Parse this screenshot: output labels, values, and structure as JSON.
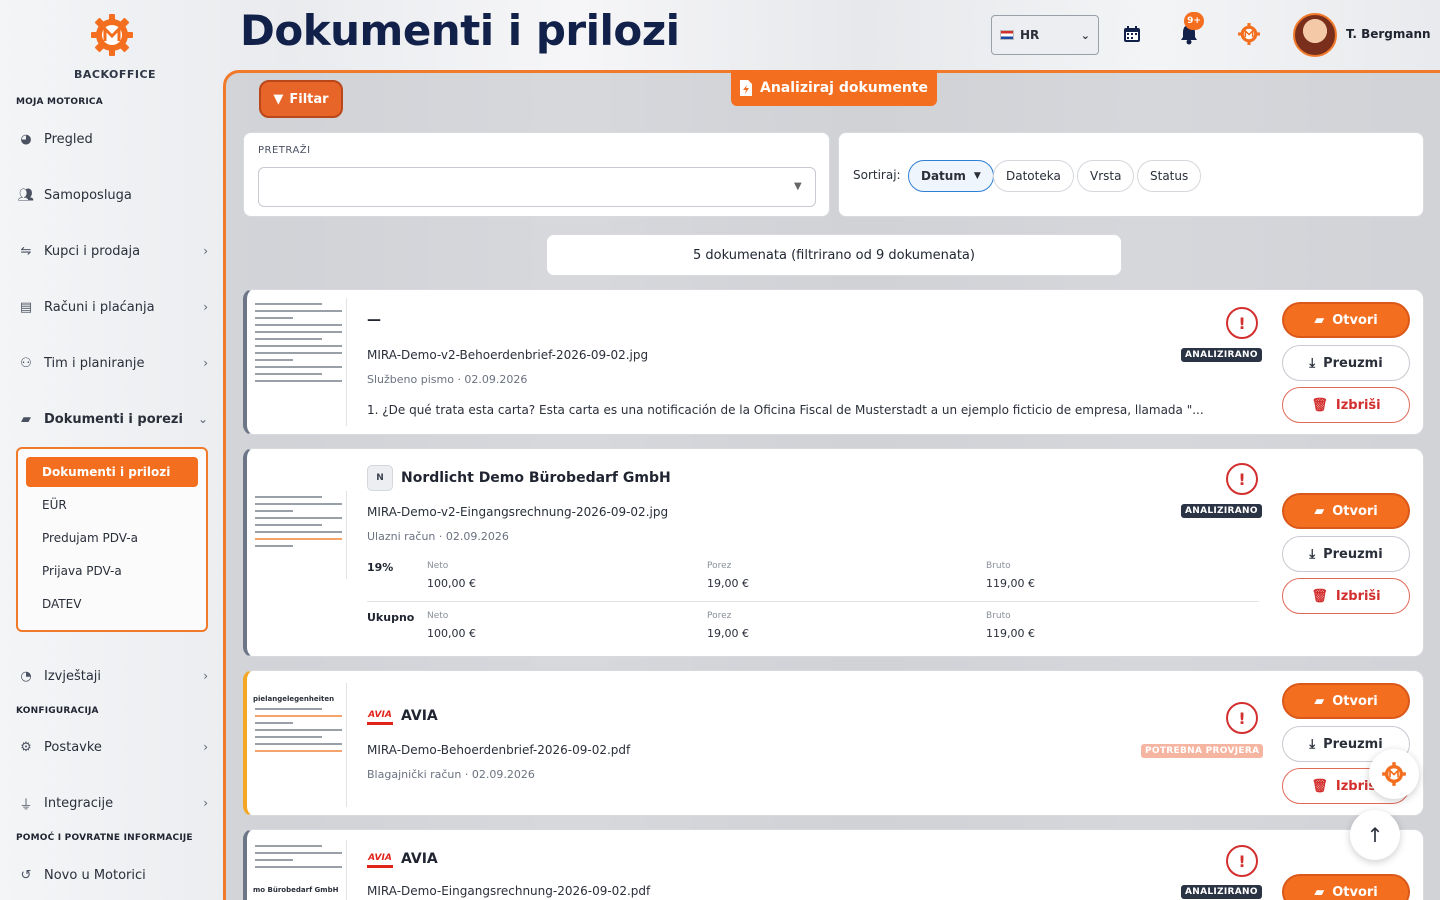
{
  "brand": {
    "name": "BACKOFFICE"
  },
  "colors": {
    "accent": "#f36f1f",
    "navy": "#12214a",
    "danger": "#d32f2f"
  },
  "sidebar": {
    "section_main": "MOJA MOTORICA",
    "items": [
      {
        "label": "Pregled",
        "icon": "palette-icon"
      },
      {
        "label": "Samoposluga",
        "icon": "users-icon"
      },
      {
        "label": "Kupci i prodaja",
        "icon": "handshake-icon"
      },
      {
        "label": "Računi i plaćanja",
        "icon": "invoice-icon"
      },
      {
        "label": "Tim i planiranje",
        "icon": "team-icon"
      },
      {
        "label": "Dokumenti i porezi",
        "icon": "folder-open-icon"
      }
    ],
    "submenu": [
      "Dokumenti i prilozi",
      "EÜR",
      "Predujam PDV-a",
      "Prijava PDV-a",
      "DATEV"
    ],
    "reports": "Izvještaji",
    "section_config": "KONFIGURACIJA",
    "settings": "Postavke",
    "integrations": "Integracije",
    "section_help": "POMOĆ I POVRATNE INFORMACIJE",
    "news": "Novo u Motorici"
  },
  "header": {
    "title": "Dokumenti i prilozi",
    "language": "HR",
    "notification_count": "9+",
    "username": "T. Bergmann"
  },
  "toolbar": {
    "filter_label": "Filtar",
    "analyze_label": "Analiziraj dokumente"
  },
  "search": {
    "label": "PRETRAŽI",
    "value": ""
  },
  "sort": {
    "label": "Sortiraj:",
    "options": [
      "Datum",
      "Datoteka",
      "Vrsta",
      "Status"
    ],
    "active": "Datum"
  },
  "summary": "5 dokumenata (filtrirano od 9 dokumenata)",
  "actions": {
    "open": "Otvori",
    "download": "Preuzmi",
    "delete": "Izbriši"
  },
  "documents": [
    {
      "title": "—",
      "filename": "MIRA-Demo-v2-Behoerdenbrief-2026-09-02.jpg",
      "meta": "Službeno pismo · 02.09.2026",
      "snippet": "1. ¿De qué trata esta carta? Esta carta es una notificación de la Oficina Fiscal de Musterstadt a un ejemplo ficticio de empresa, llamada \"...",
      "status": "ANALIZIRANO"
    },
    {
      "badge": "N",
      "title": "Nordlicht Demo Bürobedarf GmbH",
      "filename": "MIRA-Demo-v2-Eingangsrechnung-2026-09-02.jpg",
      "meta": "Ulazni račun · 02.09.2026",
      "status": "ANALIZIRANO",
      "tax": {
        "rate": "19%",
        "total_label": "Ukupno",
        "net_label": "Neto",
        "tax_label": "Porez",
        "gross_label": "Bruto",
        "net": "100,00 €",
        "tax_value": "19,00 €",
        "gross": "119,00 €",
        "total_net": "100,00 €",
        "total_tax": "19,00 €",
        "total_gross": "119,00 €"
      }
    },
    {
      "logo": "AVIA",
      "title": "AVIA",
      "filename": "MIRA-Demo-Behoerdenbrief-2026-09-02.pdf",
      "meta": "Blagajnički račun · 02.09.2026",
      "status": "POTREBNA PROVJERA",
      "thumb_text": "pielangelegenheiten"
    },
    {
      "logo": "AVIA",
      "title": "AVIA",
      "filename": "MIRA-Demo-Eingangsrechnung-2026-09-02.pdf",
      "status": "ANALIZIRANO",
      "thumb_text": "mo Bürobedarf GmbH"
    }
  ]
}
